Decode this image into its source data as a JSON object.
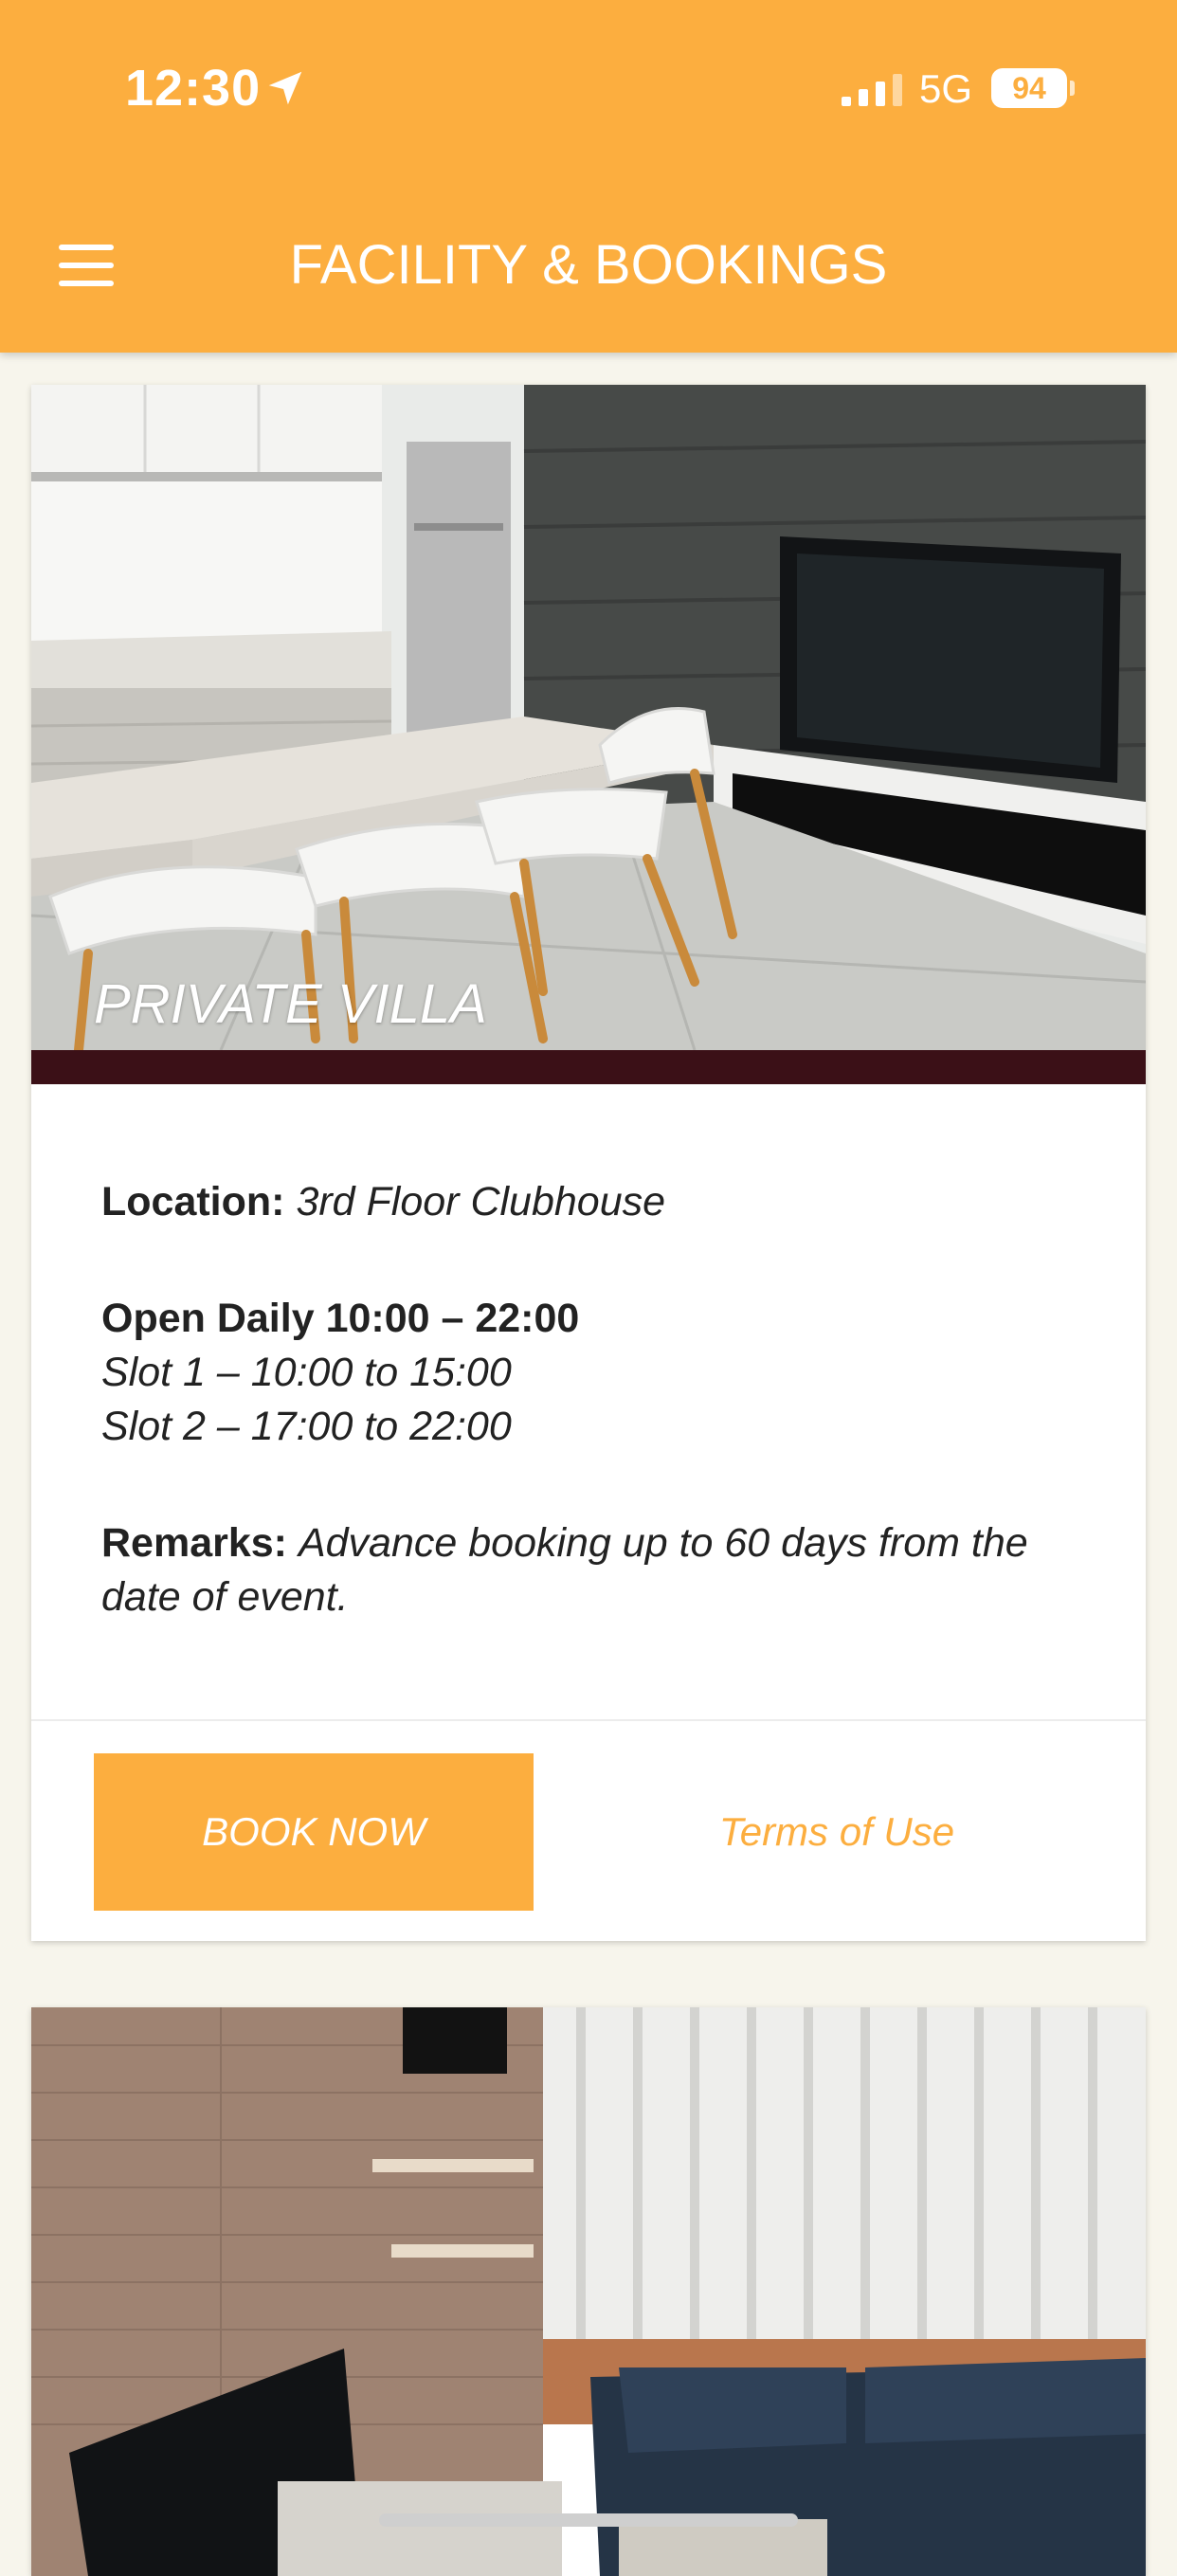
{
  "status_bar": {
    "time": "12:30",
    "network": "5G",
    "battery": "94",
    "icons": [
      "location-arrow-icon",
      "signal-icon",
      "battery-icon"
    ]
  },
  "header": {
    "title": "FACILITY & BOOKINGS",
    "menu_icon": "hamburger-menu-icon",
    "background_color": "#fcae3f"
  },
  "facilities": [
    {
      "name": "PRIVATE VILLA",
      "location_label": "Location:",
      "location": "3rd Floor Clubhouse",
      "hours_label": "Open Daily 10:00 – 22:00",
      "slot_1": "Slot 1 – 10:00 to 15:00",
      "slot_2": "Slot 2 – 17:00 to 22:00",
      "remarks_label": "Remarks:",
      "remarks": "Advance booking up to 60 days from the date of event.",
      "book_label": "BOOK NOW",
      "terms_label": "Terms of Use"
    },
    {
      "name": ""
    }
  ],
  "colors": {
    "accent": "#fcae3f",
    "page_background": "#f7f5ec",
    "image_strip": "#3b1017"
  }
}
